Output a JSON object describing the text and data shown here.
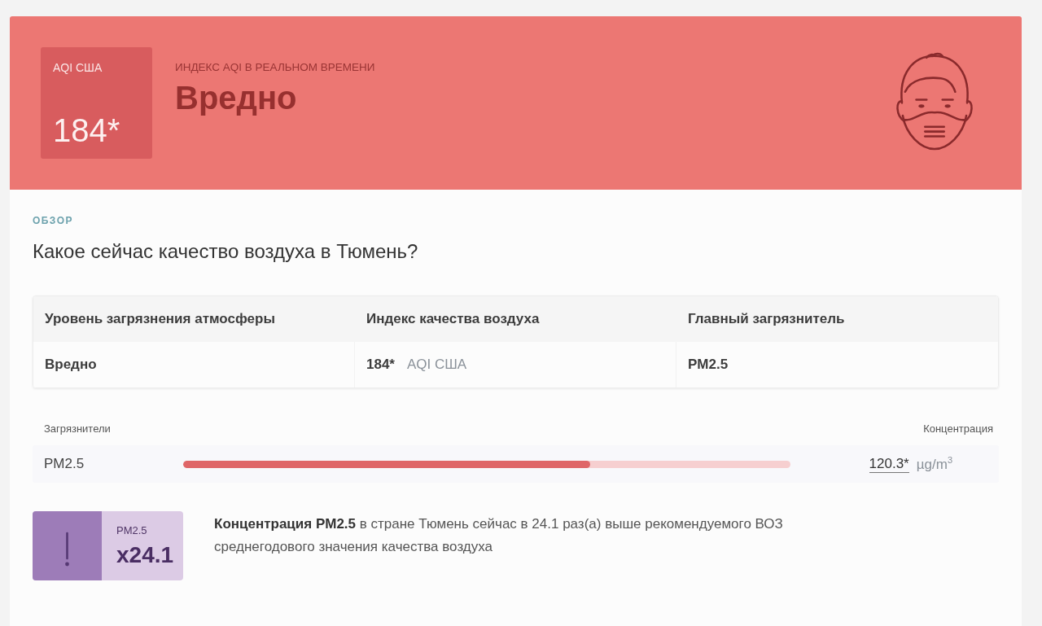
{
  "banner": {
    "score": {
      "label": "AQI США",
      "value": "184*"
    },
    "caption": "ИНДЕКС AQI В РЕАЛЬНОМ ВРЕМЕНИ",
    "status": "Вредно"
  },
  "overview": {
    "section_label": "ОБЗОР",
    "heading": "Какое сейчас качество воздуха в Тюмень?",
    "table": {
      "columns": [
        "Уровень загрязнения атмосферы",
        "Индекс качества воздуха",
        "Главный загрязнитель"
      ],
      "rows": [
        [
          {
            "value": "Вредно"
          },
          {
            "value": "184*",
            "unit": "AQI США"
          },
          {
            "value": "PM2.5"
          }
        ]
      ]
    }
  },
  "pollutants": {
    "columns": [
      "Загрязнители",
      "Концентрация"
    ],
    "items": [
      {
        "name": "PM2.5",
        "level": 0.67,
        "value": "120.3*",
        "unit": "µg/m$^{3}$"
      }
    ]
  },
  "advisory": {
    "pollutant": "PM2.5",
    "factor": "x24.1",
    "text": "**Концентрация PM2.5** в стране Тюмень сейчас в 24.1 раз(а) выше рекомендуемого ВОЗ среднегодового значения качества воздуха"
  }
}
